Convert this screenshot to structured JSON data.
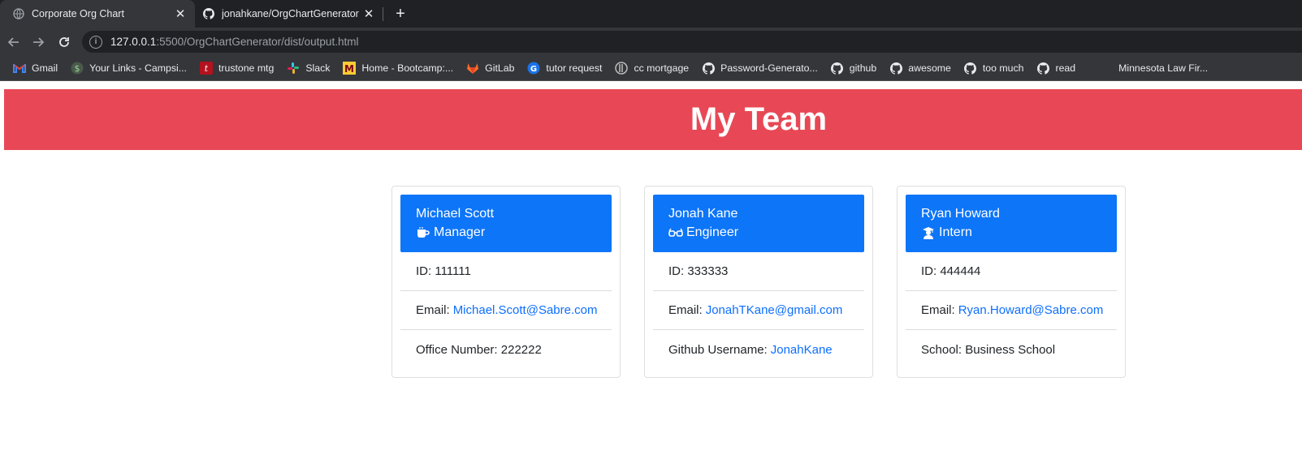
{
  "browser": {
    "tabs": [
      {
        "title": "Corporate Org Chart",
        "active": true,
        "icon": "globe-icon"
      },
      {
        "title": "jonahkane/OrgChartGenerator",
        "active": false,
        "icon": "github-icon"
      }
    ],
    "url_host": "127.0.0.1",
    "url_rest": ":5500/OrgChartGenerator/dist/output.html",
    "bookmarks": [
      {
        "label": "Gmail",
        "icon": "gmail-icon"
      },
      {
        "label": "Your Links - Campsi...",
        "icon": "dollar-icon"
      },
      {
        "label": "trustone mtg",
        "icon": "trustone-icon"
      },
      {
        "label": "Slack",
        "icon": "slack-icon"
      },
      {
        "label": "Home - Bootcamp:...",
        "icon": "bootcamp-icon"
      },
      {
        "label": "GitLab",
        "icon": "gitlab-icon"
      },
      {
        "label": "tutor request",
        "icon": "tutor-icon"
      },
      {
        "label": "cc mortgage",
        "icon": "mortgage-icon"
      },
      {
        "label": "Password-Generato...",
        "icon": "github-icon"
      },
      {
        "label": "github",
        "icon": "github-icon"
      },
      {
        "label": "awesome",
        "icon": "github-icon"
      },
      {
        "label": "too much",
        "icon": "github-icon"
      },
      {
        "label": "read",
        "icon": "github-icon"
      },
      {
        "label": "Minnesota Law Fir...",
        "icon": "blank-icon"
      }
    ]
  },
  "header": {
    "title": "My Team"
  },
  "team": [
    {
      "name": "Michael Scott",
      "role": "Manager",
      "role_icon": "mug-icon",
      "id_text": "ID: 111111",
      "email_label": "Email:",
      "email": "Michael.Scott@Sabre.com",
      "extra_label": "Office Number: 222222",
      "extra_link": ""
    },
    {
      "name": "Jonah Kane",
      "role": "Engineer",
      "role_icon": "glasses-icon",
      "id_text": "ID: 333333",
      "email_label": "Email:",
      "email": "JonahTKane@gmail.com",
      "extra_label": "Github Username:",
      "extra_link": "JonahKane"
    },
    {
      "name": "Ryan Howard",
      "role": "Intern",
      "role_icon": "graduate-icon",
      "id_text": "ID: 444444",
      "email_label": "Email:",
      "email": "Ryan.Howard@Sabre.com",
      "extra_label": "School: Business School",
      "extra_link": ""
    }
  ],
  "colors": {
    "header_bg": "#e84855",
    "card_header_bg": "#0d75f8",
    "link": "#0d6efd"
  }
}
